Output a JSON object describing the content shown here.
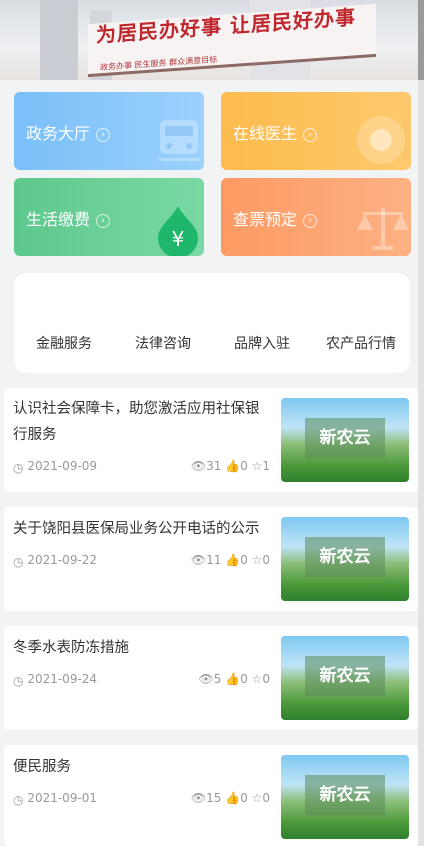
{
  "banner": {
    "slogan": "为居民办好事  让居民好办事",
    "slogan_small": "政务办事  民生服务  群众满意目标"
  },
  "services": [
    {
      "label": "政务大厅",
      "icon": "train-icon"
    },
    {
      "label": "在线医生",
      "icon": "sun-icon"
    },
    {
      "label": "生活缴费",
      "icon": "yuan-drop-icon"
    },
    {
      "label": "查票预定",
      "icon": "scale-icon"
    }
  ],
  "quick_menu": [
    "金融服务",
    "法律咨询",
    "品牌入驻",
    "农产品行情"
  ],
  "news": [
    {
      "title": "认识社会保障卡，助您激活应用社保银行服务",
      "date": "2021-09-09",
      "views": "31",
      "likes": "0",
      "stars": "1",
      "thumb": "新农云"
    },
    {
      "title": "关于饶阳县医保局业务公开电话的公示",
      "date": "2021-09-22",
      "views": "11",
      "likes": "0",
      "stars": "0",
      "thumb": "新农云"
    },
    {
      "title": "冬季水表防冻措施",
      "date": "2021-09-24",
      "views": "5",
      "likes": "0",
      "stars": "0",
      "thumb": "新农云"
    },
    {
      "title": "便民服务",
      "date": "2021-09-01",
      "views": "15",
      "likes": "0",
      "stars": "0",
      "thumb": "新农云"
    }
  ]
}
